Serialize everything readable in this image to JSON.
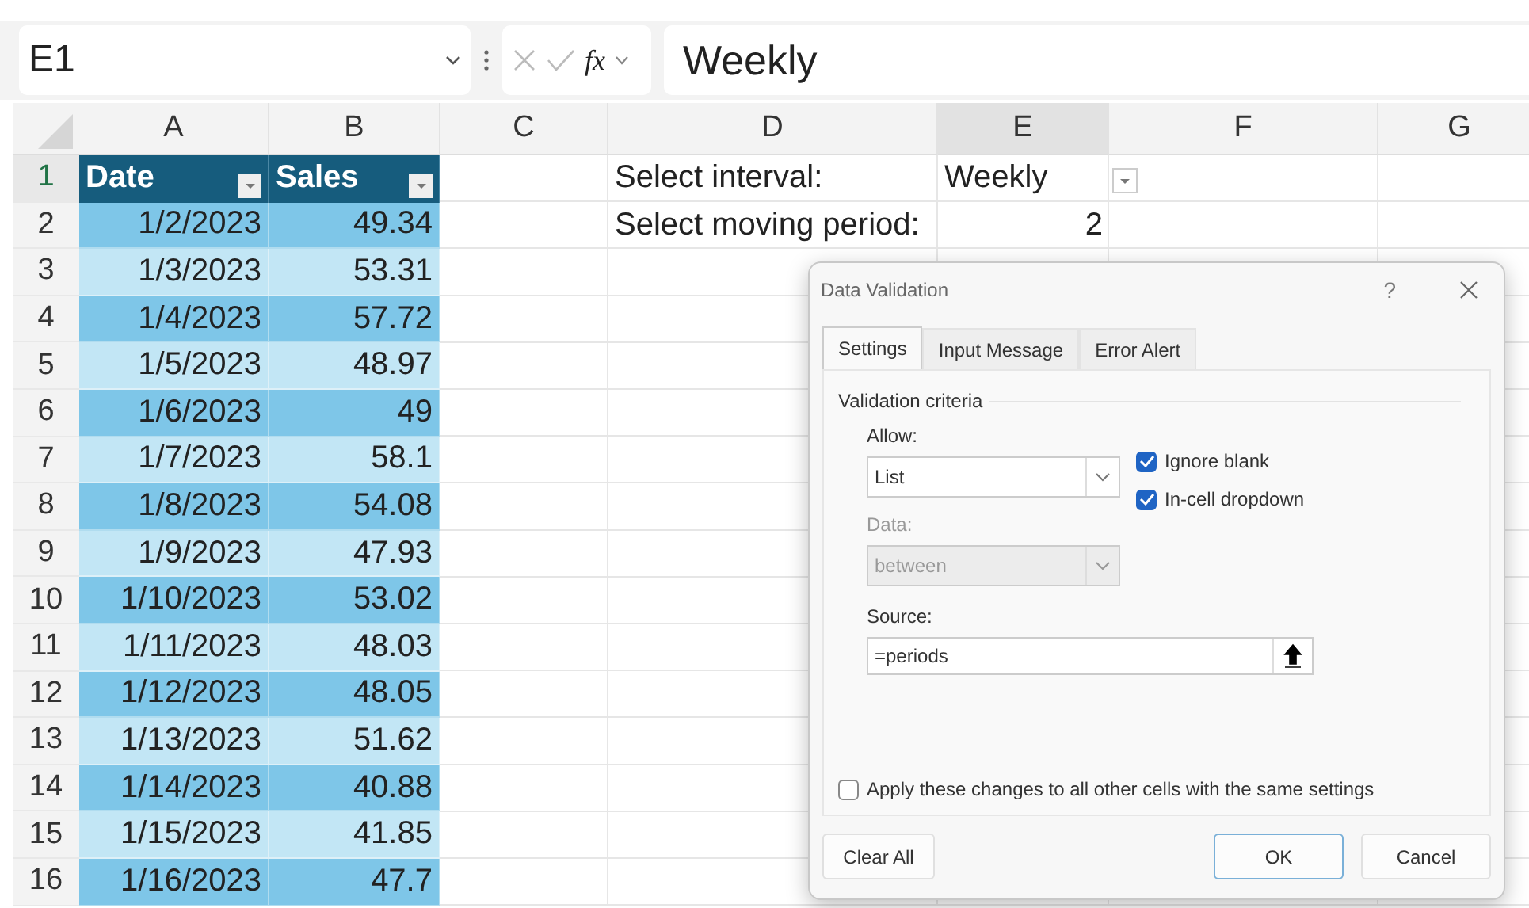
{
  "name_box": {
    "value": "E1"
  },
  "formula_bar": {
    "fx": "fx",
    "value": "Weekly"
  },
  "columns": [
    {
      "label": "A",
      "selected": false
    },
    {
      "label": "B",
      "selected": false
    },
    {
      "label": "C",
      "selected": false
    },
    {
      "label": "D",
      "selected": false
    },
    {
      "label": "E",
      "selected": true
    },
    {
      "label": "F",
      "selected": false
    },
    {
      "label": "G",
      "selected": false
    }
  ],
  "rows": [
    {
      "number": "1",
      "selected": true,
      "kind": "header",
      "a": "Date",
      "b": "Sales",
      "d": "Select interval:",
      "e": "Weekly",
      "e_dropdown": true
    },
    {
      "number": "2",
      "selected": false,
      "kind": "data",
      "a": "1/2/2023",
      "b": "49.34",
      "d": "Select moving period:",
      "e": "2"
    },
    {
      "number": "3",
      "selected": false,
      "kind": "data",
      "a": "1/3/2023",
      "b": "53.31"
    },
    {
      "number": "4",
      "selected": false,
      "kind": "data",
      "a": "1/4/2023",
      "b": "57.72"
    },
    {
      "number": "5",
      "selected": false,
      "kind": "data",
      "a": "1/5/2023",
      "b": "48.97"
    },
    {
      "number": "6",
      "selected": false,
      "kind": "data",
      "a": "1/6/2023",
      "b": "49"
    },
    {
      "number": "7",
      "selected": false,
      "kind": "data",
      "a": "1/7/2023",
      "b": "58.1"
    },
    {
      "number": "8",
      "selected": false,
      "kind": "data",
      "a": "1/8/2023",
      "b": "54.08"
    },
    {
      "number": "9",
      "selected": false,
      "kind": "data",
      "a": "1/9/2023",
      "b": "47.93"
    },
    {
      "number": "10",
      "selected": false,
      "kind": "data",
      "a": "1/10/2023",
      "b": "53.02"
    },
    {
      "number": "11",
      "selected": false,
      "kind": "data",
      "a": "1/11/2023",
      "b": "48.03"
    },
    {
      "number": "12",
      "selected": false,
      "kind": "data",
      "a": "1/12/2023",
      "b": "48.05"
    },
    {
      "number": "13",
      "selected": false,
      "kind": "data",
      "a": "1/13/2023",
      "b": "51.62"
    },
    {
      "number": "14",
      "selected": false,
      "kind": "data",
      "a": "1/14/2023",
      "b": "40.88"
    },
    {
      "number": "15",
      "selected": false,
      "kind": "data",
      "a": "1/15/2023",
      "b": "41.85"
    },
    {
      "number": "16",
      "selected": false,
      "kind": "data",
      "a": "1/16/2023",
      "b": "47.7"
    }
  ],
  "dialog": {
    "title": "Data Validation",
    "help": "?",
    "tabs": [
      {
        "label": "Settings",
        "selected": true
      },
      {
        "label": "Input Message",
        "selected": false
      },
      {
        "label": "Error Alert",
        "selected": false
      }
    ],
    "group_label": "Validation criteria",
    "allow": {
      "label": "Allow:",
      "value": "List"
    },
    "data": {
      "label": "Data:",
      "value": "between",
      "disabled": true
    },
    "checkboxes": [
      {
        "label": "Ignore blank",
        "checked": true
      },
      {
        "label": "In-cell dropdown",
        "checked": true
      }
    ],
    "source": {
      "label": "Source:",
      "value": "=periods"
    },
    "apply": {
      "label": "Apply these changes to all other cells with the same settings",
      "checked": false
    },
    "buttons": [
      {
        "label": "Clear All",
        "default": false
      },
      {
        "label": "OK",
        "default": true
      },
      {
        "label": "Cancel",
        "default": false
      }
    ]
  }
}
